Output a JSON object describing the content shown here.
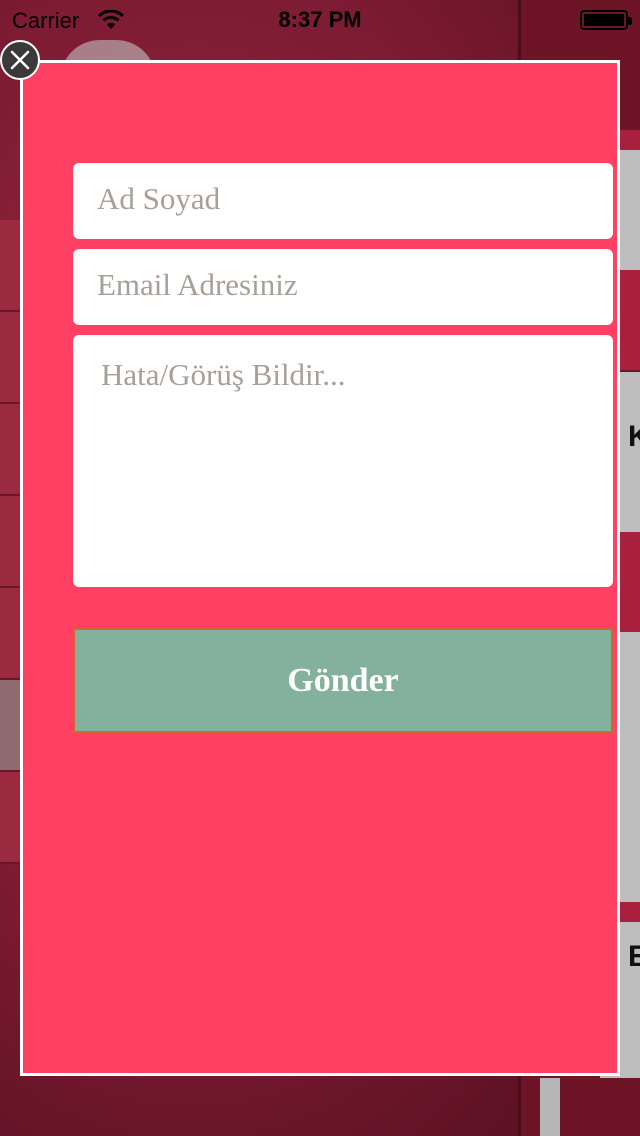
{
  "status_bar": {
    "carrier": "Carrier",
    "time": "8:37 PM",
    "wifi_icon": "wifi-icon",
    "battery_icon": "battery-icon"
  },
  "background": {
    "right_letters": [
      "K",
      "E"
    ]
  },
  "feedback_form": {
    "close_icon": "close-icon",
    "name_placeholder": "Ad Soyad",
    "email_placeholder": "Email Adresiniz",
    "message_placeholder": "Hata/Görüş Bildir...",
    "submit_label": "Gönder"
  },
  "colors": {
    "modal_background": "#ff4063",
    "submit_button": "#83b19d",
    "placeholder_text": "#a79f98"
  }
}
